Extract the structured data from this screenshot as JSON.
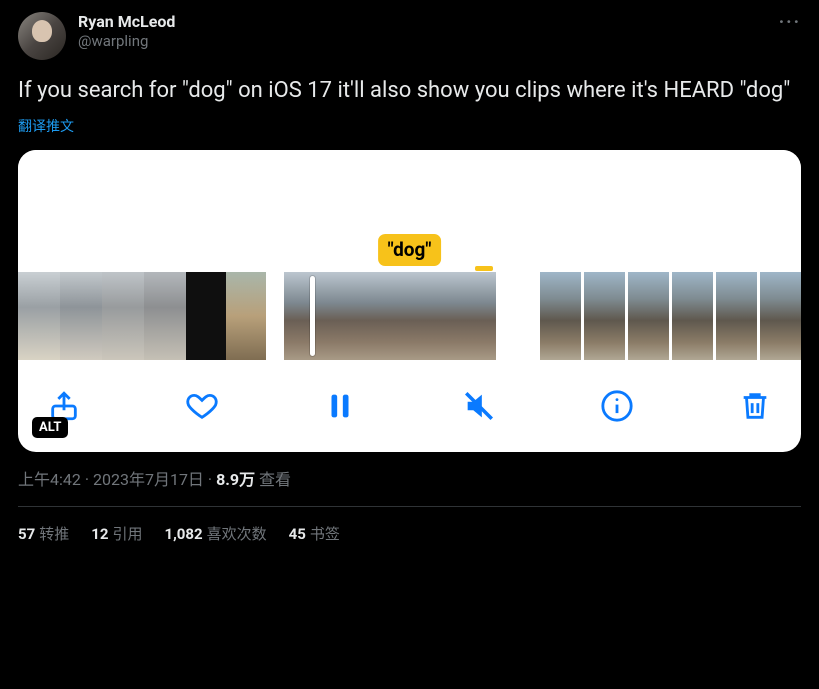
{
  "author": {
    "display_name": "Ryan McLeod",
    "handle": "@warpling"
  },
  "more_btn": "···",
  "tweet_text": "If you search for \"dog\" on iOS 17 it'll also show you clips where it's HEARD \"dog\"",
  "translate_label": "翻译推文",
  "media": {
    "search_tag": "\"dog\"",
    "alt_badge": "ALT"
  },
  "meta": {
    "time": "上午4:42",
    "dot": " · ",
    "date": "2023年7月17日",
    "views_count": "8.9万",
    "views_label": " 查看"
  },
  "stats": {
    "retweets": {
      "count": "57",
      "label": "转推"
    },
    "quotes": {
      "count": "12",
      "label": "引用"
    },
    "likes": {
      "count": "1,082",
      "label": "喜欢次数"
    },
    "bookmarks": {
      "count": "45",
      "label": "书签"
    }
  }
}
